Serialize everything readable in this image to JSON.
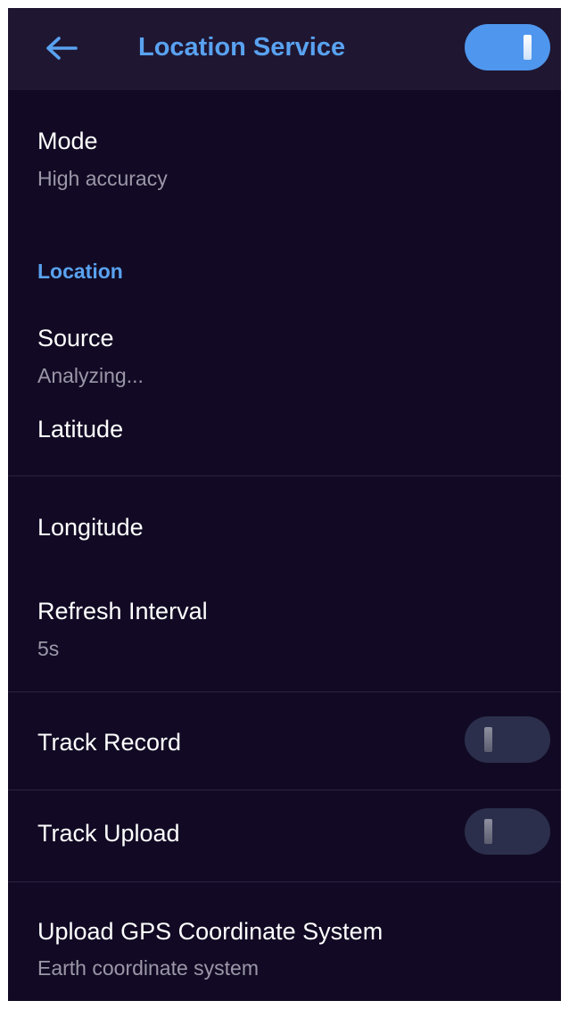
{
  "header": {
    "title": "Location Service",
    "back_icon": "arrow-left-icon",
    "service_enabled": true
  },
  "mode": {
    "label": "Mode",
    "value": "High accuracy"
  },
  "location_section": {
    "header": "Location",
    "source": {
      "label": "Source",
      "value": "Analyzing..."
    },
    "latitude": {
      "label": "Latitude"
    },
    "longitude": {
      "label": "Longitude"
    },
    "refresh_interval": {
      "label": "Refresh Interval",
      "value": "5s"
    }
  },
  "track_record": {
    "label": "Track Record",
    "enabled": false
  },
  "track_upload": {
    "label": "Track Upload",
    "enabled": false
  },
  "coordinate_system": {
    "label": "Upload GPS Coordinate System",
    "value": "Earth coordinate system"
  },
  "colors": {
    "background": "#120a24",
    "header_background": "#1f1632",
    "accent": "#59a2f0",
    "toggle_on": "#4f97ee",
    "toggle_off": "#2b2f4c",
    "primary_text": "#ffffff",
    "secondary_text": "#9b97a8"
  }
}
